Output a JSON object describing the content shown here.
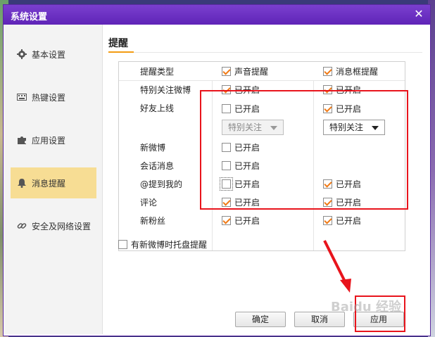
{
  "window": {
    "title": "系统设置",
    "close_glyph": "✕"
  },
  "sidebar": {
    "items": [
      {
        "label": "基本设置",
        "icon": "gear-icon"
      },
      {
        "label": "热键设置",
        "icon": "keyboard-icon"
      },
      {
        "label": "应用设置",
        "icon": "puzzle-icon"
      },
      {
        "label": "消息提醒",
        "icon": "bell-icon",
        "active": true
      },
      {
        "label": "安全及网络设置",
        "icon": "link-icon"
      }
    ]
  },
  "content": {
    "heading": "提醒",
    "table": {
      "header": {
        "type_label": "提醒类型",
        "col1": "声音提醒",
        "col2": "消息框提醒"
      },
      "rows": [
        {
          "label": "特别关注微博",
          "c1": "已开启",
          "c1_on": true,
          "c2": "已开启",
          "c2_on": true
        },
        {
          "label": "好友上线",
          "c1": "已开启",
          "c1_on": false,
          "c2": "已开启",
          "c2_on": true
        },
        {
          "label": "新微博",
          "c1": "已开启",
          "c1_on": false
        },
        {
          "label": "会话消息",
          "c1": "已开启",
          "c1_on": false
        },
        {
          "label": "@提到我的",
          "c1": "已开启",
          "c1_on": false,
          "c2": "已开启",
          "c2_on": true
        },
        {
          "label": "评论",
          "c1": "已开启",
          "c1_on": true,
          "c2": "已开启",
          "c2_on": true
        },
        {
          "label": "新粉丝",
          "c1": "已开启",
          "c1_on": true,
          "c2": "已开启",
          "c2_on": true
        }
      ],
      "friend_online_select1": "特别关注",
      "friend_online_select2": "特别关注"
    },
    "tray_option": {
      "label": "有新微博时托盘提醒",
      "checked": false
    }
  },
  "buttons": {
    "ok": "确定",
    "cancel": "取消",
    "apply": "应用"
  },
  "watermark": "Baidu 经验",
  "colors": {
    "titlebar": "#6a2dc4",
    "active_item": "#f7dd94",
    "check": "#f07a16",
    "annotation": "#e8141c"
  }
}
